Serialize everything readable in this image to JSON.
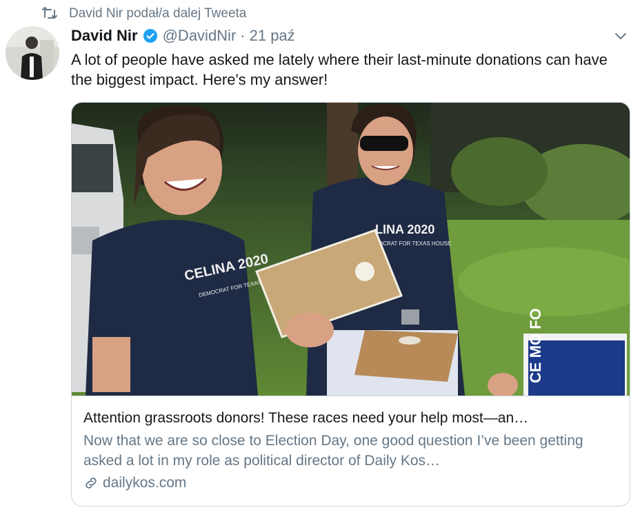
{
  "retweet": {
    "text": "David Nir podał/a dalej Tweeta"
  },
  "tweet": {
    "author_name": "David Nir",
    "handle": "@DavidNir",
    "separator": "·",
    "time": "21 paź",
    "text": "A lot of people have asked me lately where their last-minute donations can have the biggest impact. Here's my answer!"
  },
  "card": {
    "title": "Attention grassroots donors! These races need your help most—an…",
    "description": "Now that we are so close to Election Day, one good question I’ve been getting asked a lot in my role as political director of Daily Kos…",
    "domain": "dailykos.com",
    "image_text": {
      "shirt_front": "CELINA 2020",
      "shirt_front_sub": "DEMOCRAT FOR TEXAS HOUSE",
      "shirt_back": "LINA 2020",
      "shirt_back_sub": "OCRAT FOR TEXAS HOUSE",
      "yard_sign": "CE MO FO"
    }
  },
  "colors": {
    "accent": "#1da1f2",
    "secondary_text": "#657786",
    "border": "#ccd6dd"
  },
  "icons": [
    "retweet-icon",
    "verified-badge-icon",
    "chevron-down-icon",
    "link-icon"
  ]
}
